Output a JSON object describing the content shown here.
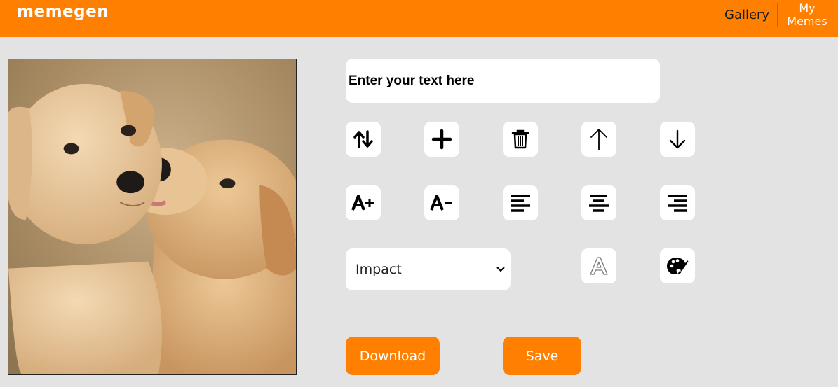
{
  "header": {
    "logo": "memegen",
    "nav": {
      "gallery": "Gallery",
      "my_memes_line1": "My",
      "my_memes_line2": "Memes"
    }
  },
  "editor": {
    "text_input": {
      "placeholder": "Enter your text here",
      "value": ""
    },
    "font_select": {
      "selected": "Impact"
    },
    "buttons": {
      "switch_line": "swap-vertical-icon",
      "add_line": "plus-icon",
      "delete_line": "trash-icon",
      "move_up": "arrow-up-icon",
      "move_down": "arrow-down-icon",
      "increase_font": "A+",
      "decrease_font": "A-",
      "align_left": "align-left-icon",
      "align_center": "align-center-icon",
      "align_right": "align-right-icon",
      "stroke": "A",
      "color": "palette-icon"
    },
    "download_label": "Download",
    "save_label": "Save"
  },
  "colors": {
    "brand": "#ff7f00",
    "background": "#e3e3e3"
  }
}
